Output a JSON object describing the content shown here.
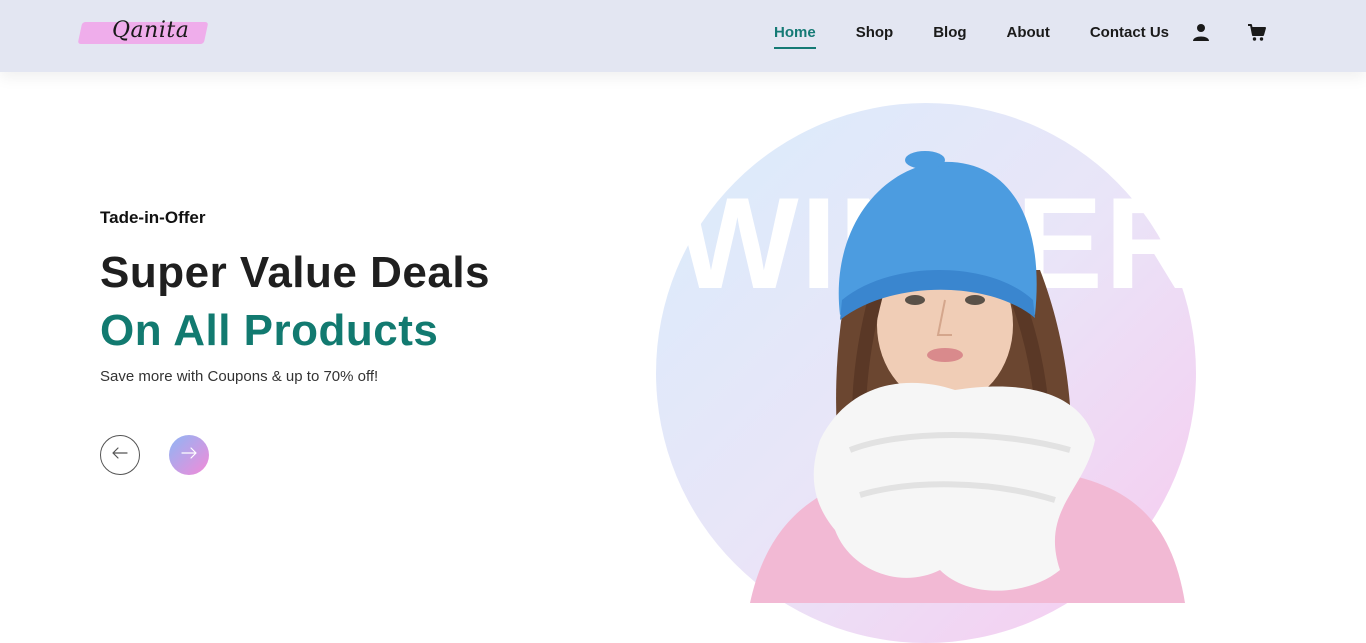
{
  "header": {
    "logo_text": "Qanita",
    "nav": [
      {
        "label": "Home",
        "active": true
      },
      {
        "label": "Shop",
        "active": false
      },
      {
        "label": "Blog",
        "active": false
      },
      {
        "label": "About",
        "active": false
      },
      {
        "label": "Contact Us",
        "active": false
      }
    ],
    "icons": [
      "user-icon",
      "cart-icon"
    ]
  },
  "hero": {
    "eyebrow": "Tade-in-Offer",
    "title_line1": "Super Value Deals",
    "title_line2": "On All Products",
    "subtitle": "Save more with Coupons & up to 70% off!",
    "background_word": "WINTER",
    "prev_icon": "arrow-left-icon",
    "next_icon": "arrow-right-icon"
  },
  "colors": {
    "accent": "#127a70",
    "header_bg": "#e3e6f2",
    "logo_brush": "#f0a6ea",
    "gradient_start": "#8eb6f5",
    "gradient_end": "#f38ad8"
  }
}
